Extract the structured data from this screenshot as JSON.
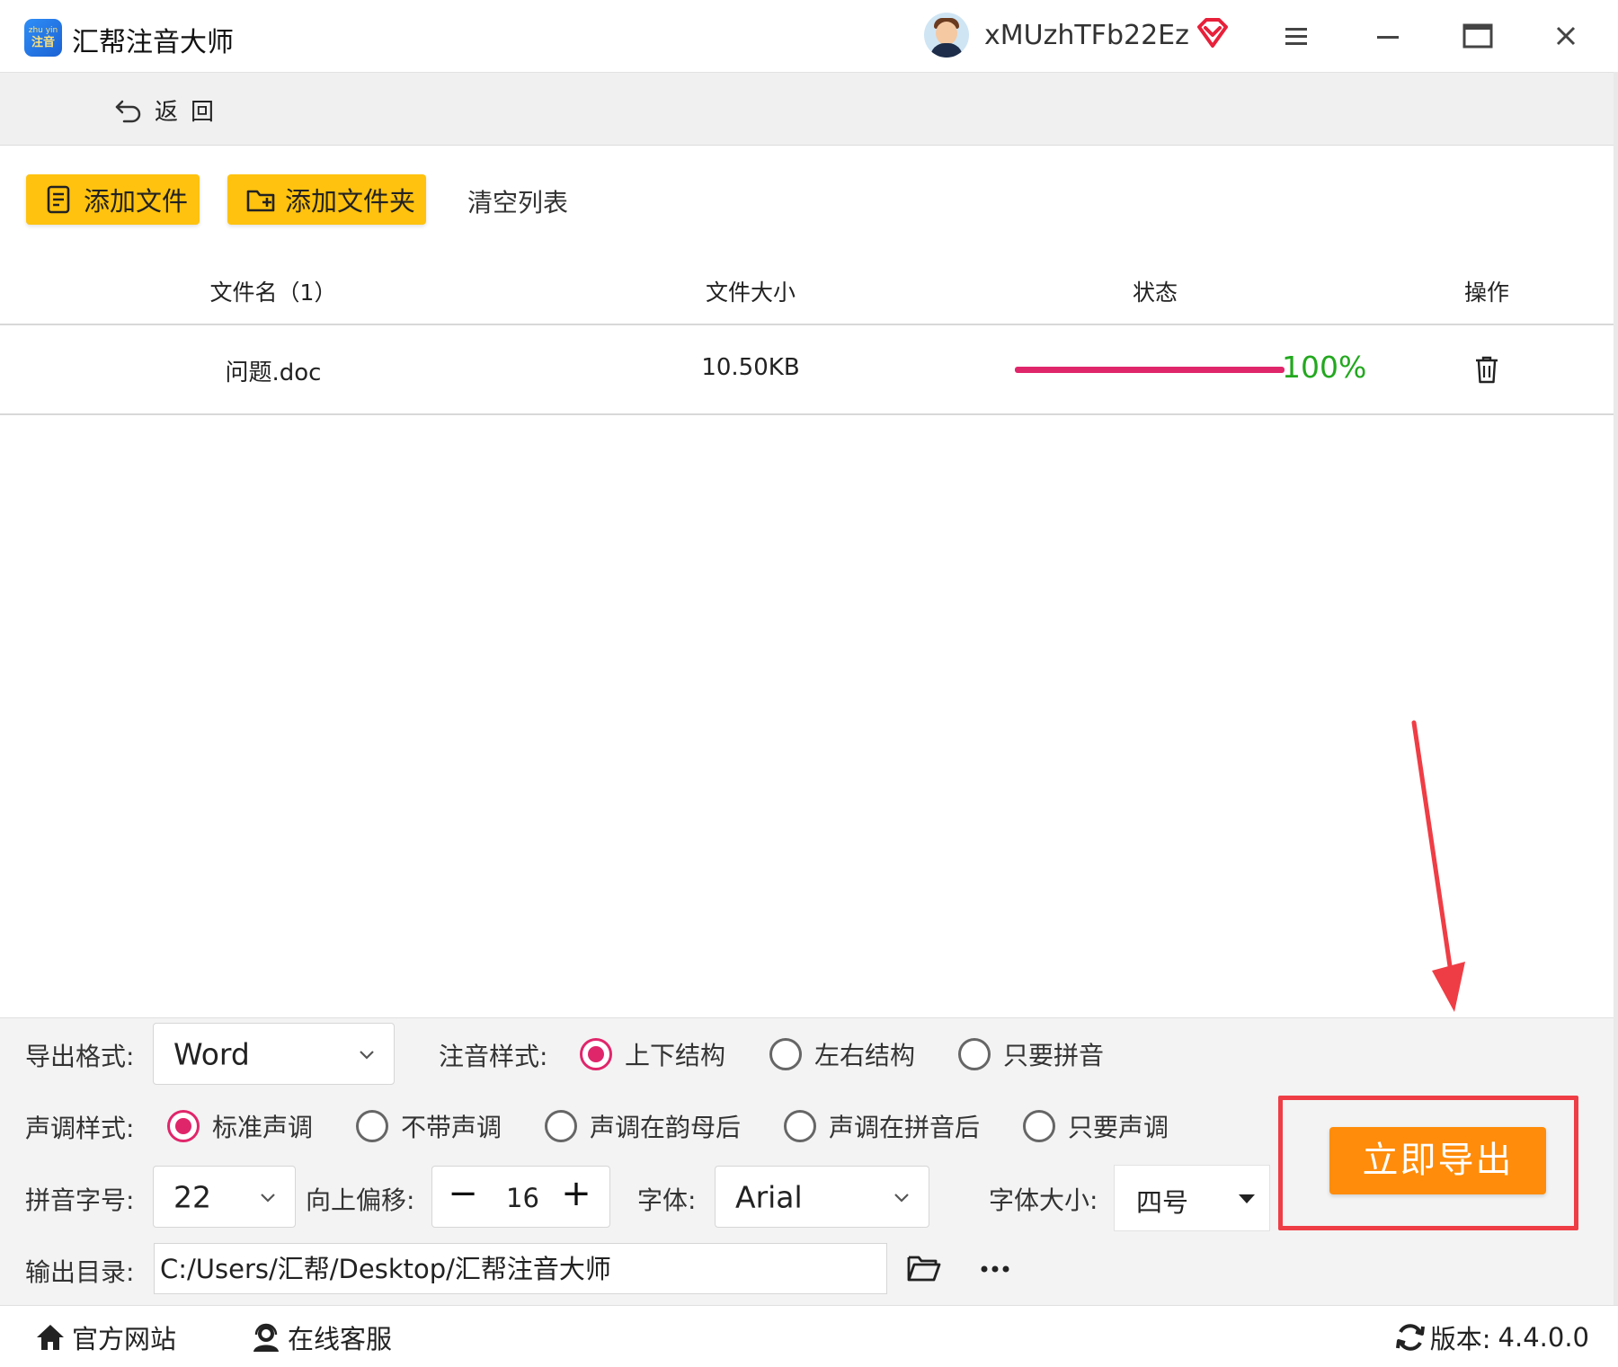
{
  "app": {
    "logo_text_top": "zhu yin",
    "logo_text_main": "注音",
    "title": "汇帮注音大师",
    "username": "xMUzhTFb22Ez",
    "vip_color": "#e8203a",
    "accent_pink": "#e0266b",
    "accent_yellow": "#ffc20e",
    "accent_orange": "#ff8c0a"
  },
  "nav": {
    "back_label": "返回"
  },
  "toolbar": {
    "add_file": "添加文件",
    "add_folder": "添加文件夹",
    "clear_list": "清空列表"
  },
  "table": {
    "headers": [
      "文件名（1）",
      "文件大小",
      "状态",
      "操作"
    ],
    "rows": [
      {
        "name": "问题.doc",
        "size": "10.50KB",
        "progress": 1.0,
        "progress_label": "100%",
        "action_icon": "trash-icon"
      }
    ]
  },
  "settings": {
    "export_format_label": "导出格式:",
    "export_format_value": "Word",
    "annotation_style_label": "注音样式:",
    "annotation_options": [
      "上下结构",
      "左右结构",
      "只要拼音"
    ],
    "annotation_selected": 0,
    "tone_style_label": "声调样式:",
    "tone_options": [
      "标准声调",
      "不带声调",
      "声调在韵母后",
      "声调在拼音后",
      "只要声调"
    ],
    "tone_selected": 0,
    "pinyin_size_label": "拼音字号:",
    "pinyin_size_value": "22",
    "offset_label": "向上偏移:",
    "offset_value": "16",
    "offset_minus": "−",
    "offset_plus": "+",
    "font_label": "字体:",
    "font_value": "Arial",
    "font_size_label": "字体大小:",
    "font_size_value": "四号",
    "output_dir_label": "输出目录:",
    "output_dir_value": "C:/Users/汇帮/Desktop/汇帮注音大师",
    "export_button": "立即导出"
  },
  "footer": {
    "website": "官方网站",
    "support": "在线客服",
    "version_label": "版本:",
    "version_value": "4.4.0.0"
  }
}
